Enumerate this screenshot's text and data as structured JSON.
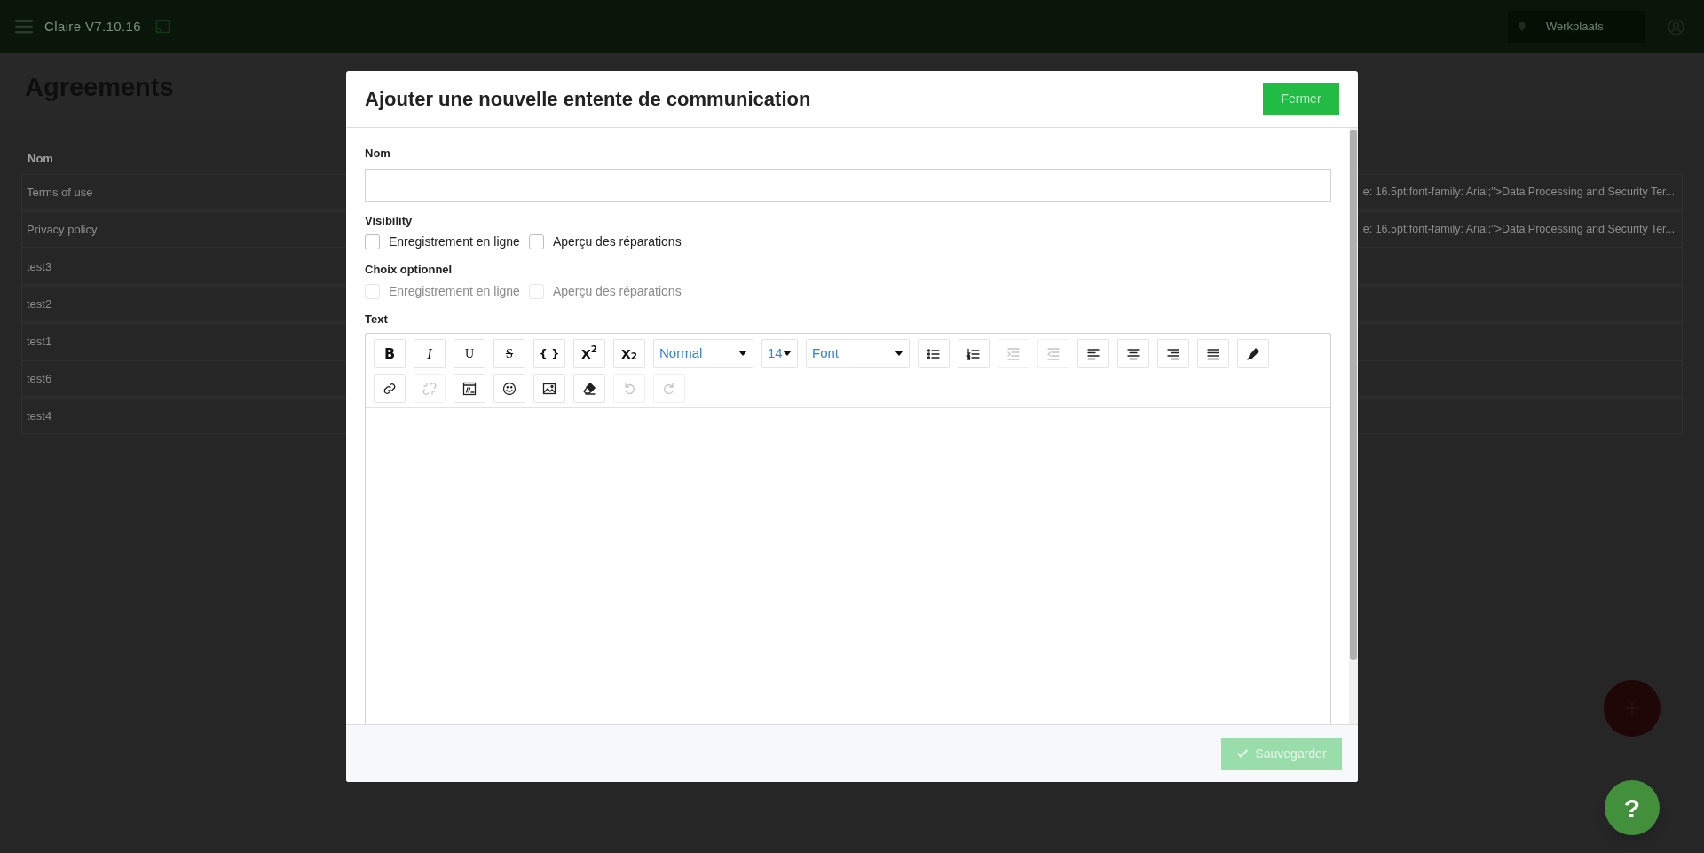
{
  "topbar": {
    "app_title": "Claire V7.10.16",
    "location": "Werkplaats"
  },
  "page": {
    "title": "Agreements",
    "table": {
      "columns": [
        "Nom"
      ],
      "rows": [
        {
          "name": "Terms of use",
          "column_2": "e: 16.5pt;font-family: Arial;\">Data Processing and Security Ter..."
        },
        {
          "name": "Privacy policy",
          "column_2": "e: 16.5pt;font-family: Arial;\">Data Processing and Security Ter..."
        },
        {
          "name": "test3"
        },
        {
          "name": "test2"
        },
        {
          "name": "test1"
        },
        {
          "name": "test6"
        },
        {
          "name": "test4"
        }
      ]
    }
  },
  "modal": {
    "title": "Ajouter une nouvelle entente de communication",
    "close_button": "Fermer",
    "name_field": {
      "label": "Nom"
    },
    "checkbox_groups": [
      {
        "label": "Visibility",
        "disabled": false,
        "options": [
          {
            "label": "Enregistrement en ligne",
            "checked": false
          },
          {
            "label": "Aperçu des réparations",
            "checked": false
          }
        ]
      },
      {
        "label": "Choix optionnel",
        "disabled": true,
        "options": [
          {
            "label": "Enregistrement en ligne",
            "checked": false
          },
          {
            "label": "Aperçu des réparations",
            "checked": false
          }
        ]
      }
    ],
    "editor": {
      "label": "Text",
      "toolbar_rows": [
        [
          {
            "kind": "glyph",
            "text": "B"
          },
          {
            "kind": "glyph",
            "text": "I"
          },
          {
            "kind": "glyph",
            "text": "U"
          },
          {
            "kind": "glyph",
            "text": "S"
          },
          {
            "kind": "glyph",
            "text": "{ }"
          },
          {
            "kind": "glyph",
            "text": "X$^{2}$"
          },
          {
            "kind": "glyph",
            "text": "X$_{2}$"
          },
          {
            "kind": "select",
            "label": "Normal"
          },
          {
            "kind": "select",
            "label": "14"
          },
          {
            "kind": "select",
            "label": "Font"
          },
          {
            "kind": "icon",
            "disabled": false
          },
          {
            "kind": "icon",
            "disabled": false
          },
          {
            "kind": "icon",
            "disabled": true
          },
          {
            "kind": "icon",
            "disabled": true
          },
          {
            "kind": "icon",
            "disabled": false
          },
          {
            "kind": "icon",
            "disabled": false
          },
          {
            "kind": "icon",
            "disabled": false
          },
          {
            "kind": "icon",
            "disabled": false
          },
          {
            "kind": "icon",
            "disabled": false
          }
        ],
        [
          {
            "kind": "icon",
            "disabled": false
          },
          {
            "kind": "icon",
            "disabled": true
          },
          {
            "kind": "icon",
            "disabled": false
          },
          {
            "kind": "icon",
            "disabled": false
          },
          {
            "kind": "icon",
            "disabled": false
          },
          {
            "kind": "icon",
            "disabled": false
          },
          {
            "kind": "icon",
            "disabled": true
          },
          {
            "kind": "icon",
            "disabled": true
          }
        ]
      ]
    },
    "save_button": {
      "label": "Sauvegarder",
      "disabled": true
    }
  },
  "help_button": "?"
}
